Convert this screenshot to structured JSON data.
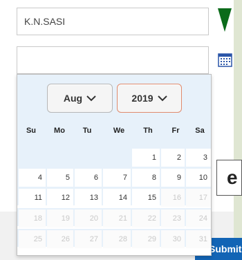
{
  "form": {
    "name_value": "K.N.SASI",
    "date_value": ""
  },
  "side_box_text": "e",
  "submit_label": "Submit",
  "datepicker": {
    "selected_month": "Aug",
    "selected_year": "2019",
    "weekdays": [
      "Su",
      "Mo",
      "Tu",
      "We",
      "Th",
      "Fr",
      "Sa"
    ],
    "weeks": [
      [
        "",
        "",
        "",
        "",
        "1",
        "2",
        "3"
      ],
      [
        "4",
        "5",
        "6",
        "7",
        "8",
        "9",
        "10"
      ],
      [
        "11",
        "12",
        "13",
        "14",
        "15",
        "16",
        "17"
      ],
      [
        "18",
        "19",
        "20",
        "21",
        "22",
        "23",
        "24"
      ],
      [
        "25",
        "26",
        "27",
        "28",
        "29",
        "30",
        "31"
      ]
    ],
    "last_enabled_day": 15
  },
  "colors": {
    "accent_green": "#0b6b1a",
    "submit_blue": "#1264b5",
    "picker_bg": "#e7f1fa"
  }
}
